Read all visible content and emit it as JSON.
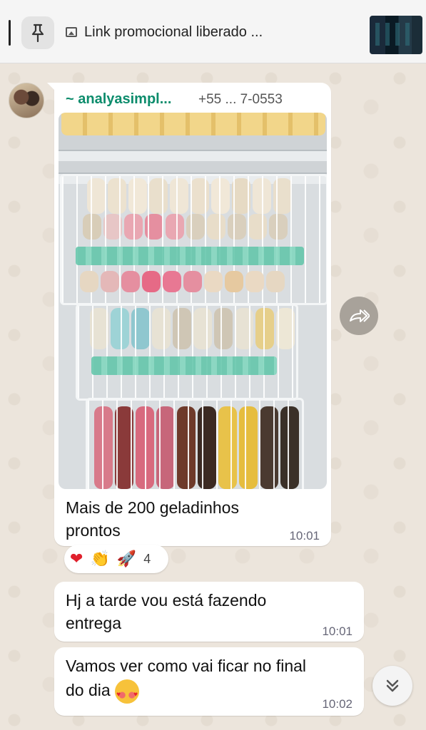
{
  "pinned": {
    "text": "Link promocional liberado ...",
    "icon": "pin-icon",
    "media_icon": "image-icon"
  },
  "message1": {
    "sender": "~ analyasimpl...",
    "phone": "+55 ... 7-0553",
    "caption_line1": "Mais de 200 geladinhos",
    "caption_line2": "prontos",
    "time": "10:01"
  },
  "reactions": {
    "heart": "❤",
    "clap": "👏",
    "rocket": "🚀",
    "count": "4"
  },
  "message2": {
    "line1": "Hj a tarde vou está fazendo",
    "line2": "entrega",
    "time": "10:01"
  },
  "message3": {
    "line1": "Vamos ver como vai ficar no final",
    "line2": "do dia",
    "time": "10:02"
  },
  "colors": {
    "sender_name": "#0c8c6c",
    "wallpaper": "#ece5dc",
    "bubble": "#ffffff"
  }
}
